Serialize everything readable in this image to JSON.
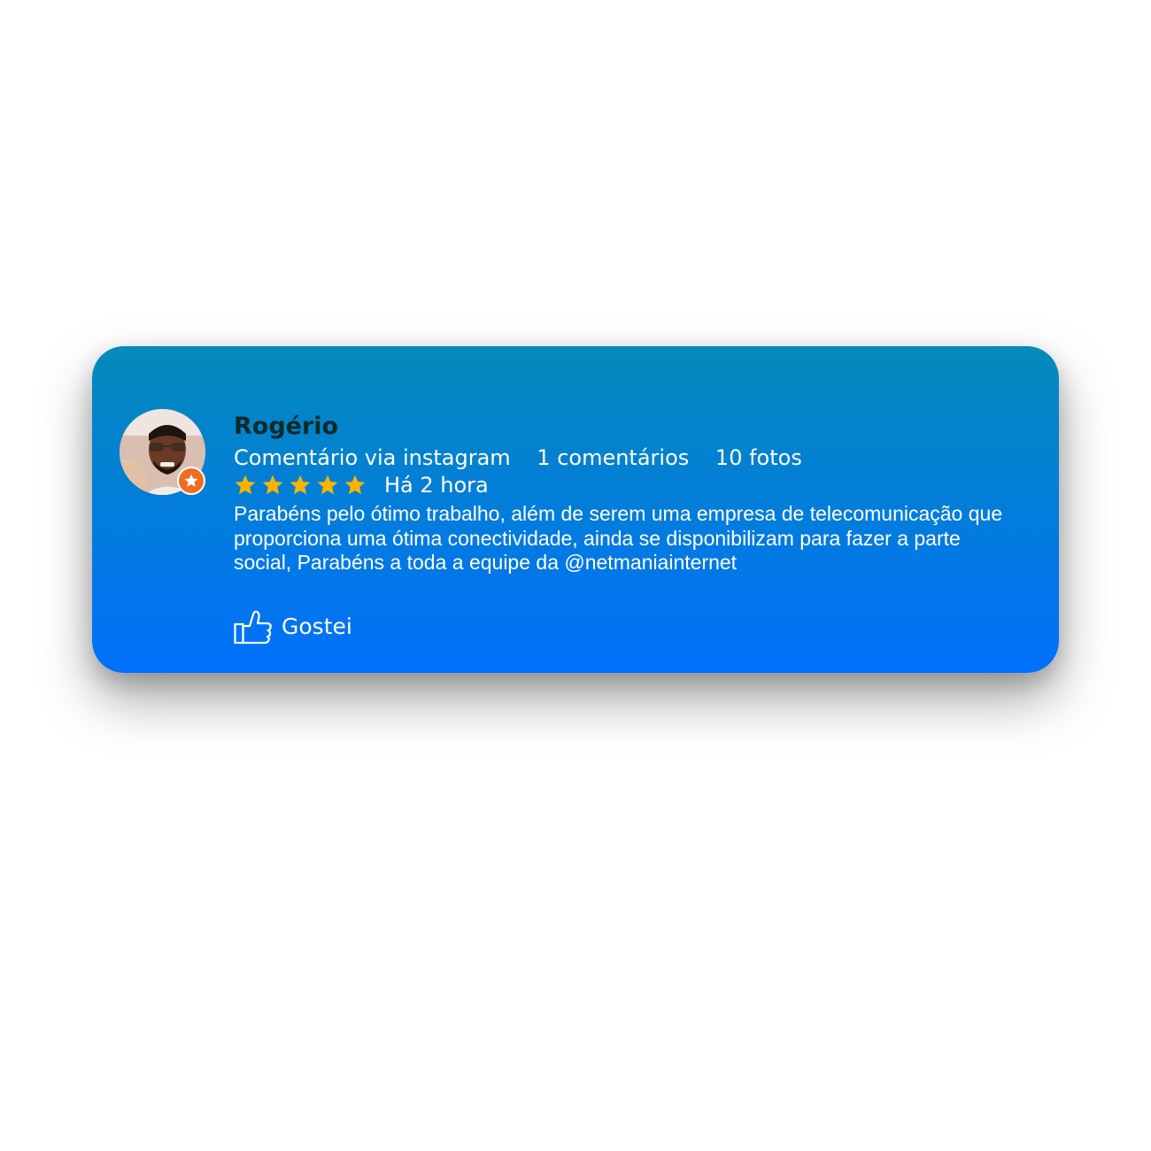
{
  "review": {
    "author": "Rogério",
    "source": "Comentário via instagram",
    "comments_count": "1 comentários",
    "photos_count": "10 fotos",
    "rating": 5,
    "rating_max": 5,
    "time": "Há 2 hora",
    "text": "Parabéns pelo ótimo trabalho, além de serem uma empresa de telecomunicação que proporciona uma ótima conectividade, ainda se disponibilizam para fazer a parte social, Parabéns a toda a equipe da @netmaniainternet",
    "like_label": "Gostei"
  },
  "colors": {
    "card_top": "#048aba",
    "card_bottom": "#0170fb",
    "star": "#f6b400",
    "badge": "#f26c20",
    "name": "#0d2a2a"
  },
  "icons": {
    "badge": "star-icon",
    "rating": "star-icon",
    "like": "thumbs-up-icon"
  }
}
